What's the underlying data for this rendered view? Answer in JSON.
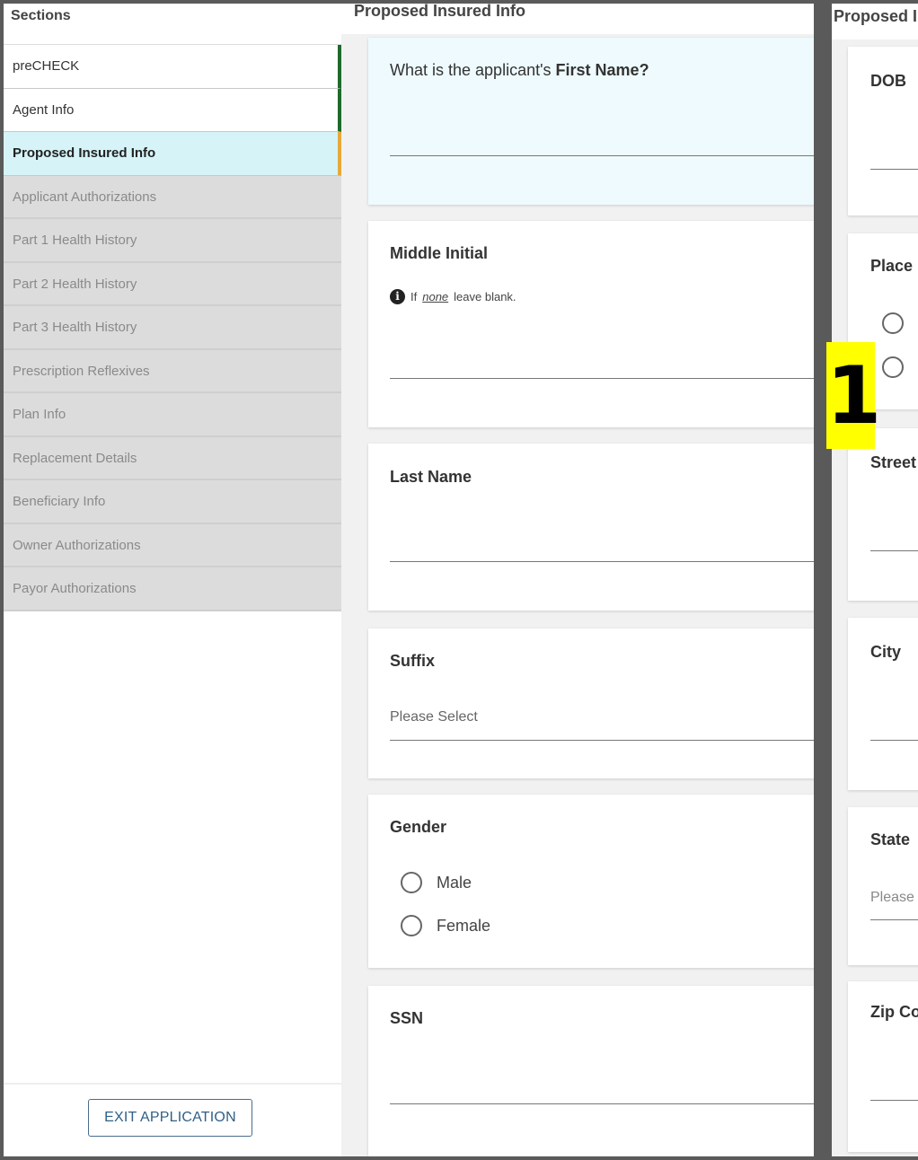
{
  "sidebar": {
    "header": "Sections",
    "items": [
      {
        "label": "preCHECK",
        "state": "done"
      },
      {
        "label": "Agent Info",
        "state": "done"
      },
      {
        "label": "Proposed Insured Info",
        "state": "active"
      },
      {
        "label": "Applicant Authorizations",
        "state": "pending"
      },
      {
        "label": "Part 1 Health History",
        "state": "pending"
      },
      {
        "label": "Part 2 Health History",
        "state": "pending"
      },
      {
        "label": "Part 3 Health History",
        "state": "pending"
      },
      {
        "label": "Prescription Reflexives",
        "state": "pending"
      },
      {
        "label": "Plan Info",
        "state": "pending"
      },
      {
        "label": "Replacement Details",
        "state": "pending"
      },
      {
        "label": "Beneficiary Info",
        "state": "pending"
      },
      {
        "label": "Owner Authorizations",
        "state": "pending"
      },
      {
        "label": "Payor Authorizations",
        "state": "pending"
      }
    ],
    "exit_label": "EXIT APPLICATION"
  },
  "main": {
    "header": "Proposed Insured Info",
    "first_name": {
      "prefix": "What is the applicant's ",
      "bold": "First Name?"
    },
    "middle_initial": {
      "label": "Middle Initial",
      "hint_if": "If",
      "hint_none": "none",
      "hint_rest": "leave blank."
    },
    "last_name": {
      "label": "Last Name"
    },
    "suffix": {
      "label": "Suffix",
      "placeholder": "Please Select"
    },
    "gender": {
      "label": "Gender",
      "options": [
        "Male",
        "Female"
      ]
    },
    "ssn": {
      "label": "SSN"
    }
  },
  "right": {
    "header": "Proposed I",
    "dob": "DOB",
    "place": "Place",
    "street": "Street",
    "city": "City",
    "state": "State",
    "state_placeholder": "Please",
    "zip": "Zip Co"
  },
  "marker": "1",
  "colors": {
    "active_bg": "#d6f3f8",
    "active_accent": "#e7a93a",
    "done_accent": "#1f6b2a",
    "pending_bg": "#dcdcdc",
    "exit_border": "#4a6d8c",
    "marker_bg": "#ffff00"
  },
  "icons": [
    "info-icon",
    "radio-icon"
  ]
}
